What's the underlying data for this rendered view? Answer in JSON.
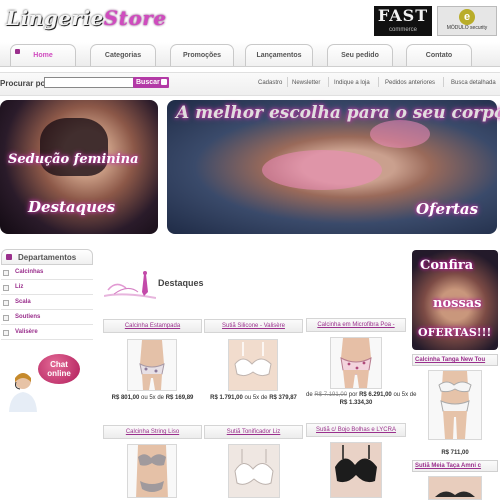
{
  "header": {
    "logo_part1": "Lingerie",
    "logo_part2": "Store",
    "badge_fast_title": "FAST",
    "badge_fast_sub": "commerce",
    "badge_modulo_letter": "e",
    "badge_modulo_sub": "MÓDULO security"
  },
  "tabs": [
    {
      "label": "Home",
      "active": true
    },
    {
      "label": "Categorias"
    },
    {
      "label": "Promoções"
    },
    {
      "label": "Lançamentos"
    },
    {
      "label": "Seu pedido"
    },
    {
      "label": "Contato"
    }
  ],
  "search": {
    "label": "Procurar por:",
    "value": "",
    "button": "Buscar"
  },
  "toplinks": [
    "Cadastro",
    "Newsletter",
    "Indique a loja",
    "Pedidos anteriores",
    "Busca detalhada"
  ],
  "banners": {
    "left_line1": "Sedução feminina",
    "left_line2": "Destaques",
    "right_line1": "A melhor escolha para o seu corpo!",
    "right_line2": "Ofertas"
  },
  "departments": {
    "title": "Departamentos",
    "items": [
      "Calcinhas",
      "Liz",
      "Scala",
      "Soutiens",
      "Valisère"
    ]
  },
  "chat": {
    "line1": "Chat",
    "line2": "online"
  },
  "destaques": {
    "title": "Destaques",
    "row1": [
      {
        "title": "Calcinha Estampada",
        "price": "R$ 801,00",
        "installments": "ou 5x de",
        "installment_value": "R$ 169,89"
      },
      {
        "title": "Sutiã Silicone - Valisère",
        "price": "R$ 1.791,00",
        "installments": "ou 5x de",
        "installment_value": "R$ 379,87"
      },
      {
        "title": "Calcinha em Microfibra Poa -",
        "old_price": "R$ 7.191,00",
        "price_prefix": "de",
        "price_mid": "por",
        "price": "R$ 6.291,00",
        "installments": "ou 5x de",
        "installment_value": "R$ 1.334,30"
      }
    ],
    "row2": [
      {
        "title": "Calcinha String Liso"
      },
      {
        "title": "Sutiã Tonificador Liz"
      },
      {
        "title": "Sutiã c/ Bojo Bolhas e LYCRA"
      }
    ]
  },
  "right_column": {
    "promo_line1": "Confira",
    "promo_line2": "nossas",
    "promo_line3": "OFERTAS!!!",
    "product1_title": "Calcinha Tanga New Tou",
    "product1_price": "R$ 711,00",
    "product2_title": "Sutiã Meia Taça Amni c"
  }
}
